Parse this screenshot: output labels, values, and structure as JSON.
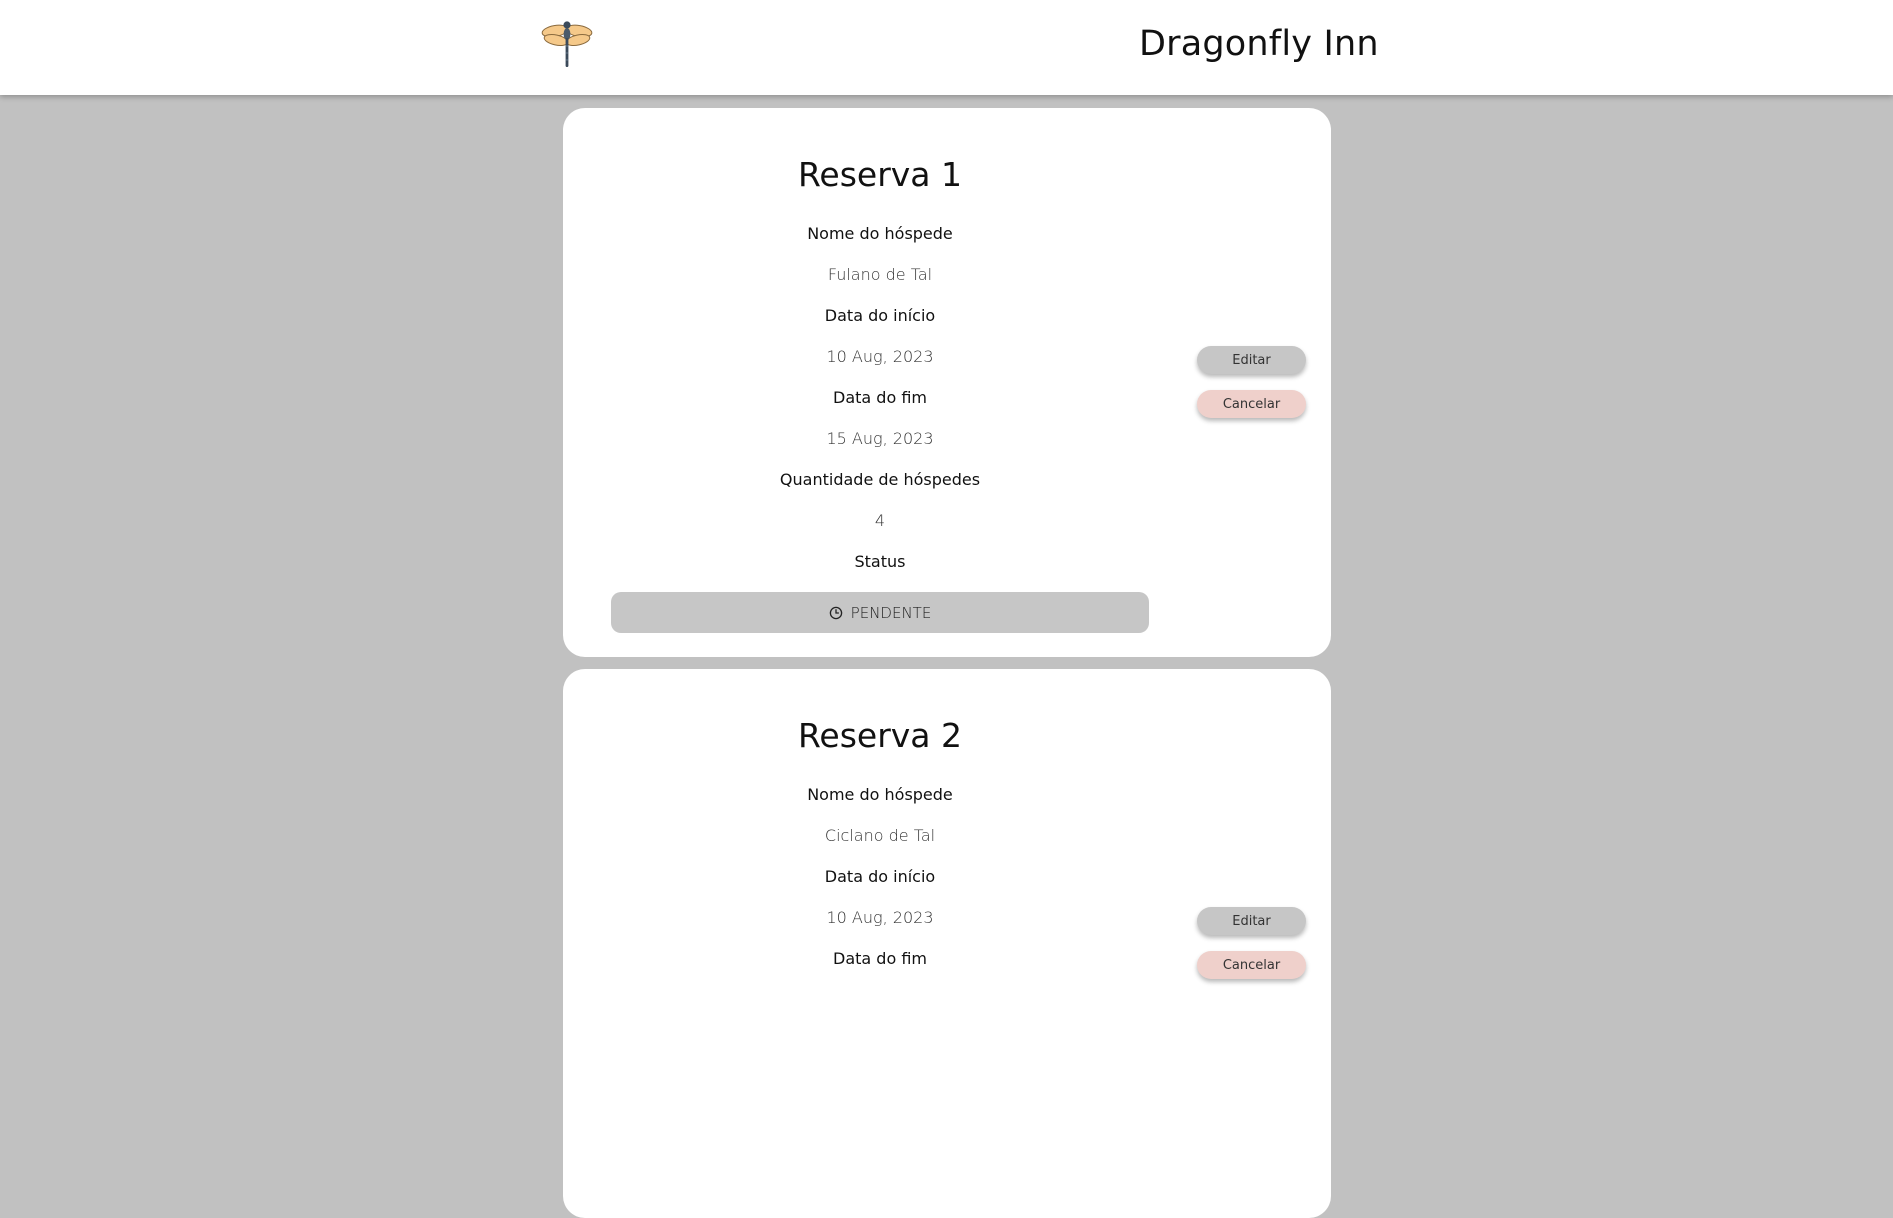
{
  "header": {
    "brand": "Dragonfly Inn",
    "logo_icon": "dragonfly-icon"
  },
  "labels": {
    "guest_name": "Nome do hóspede",
    "start_date": "Data do início",
    "end_date": "Data do fim",
    "guest_count": "Quantidade de hóspedes",
    "status": "Status",
    "edit": "Editar",
    "cancel": "Cancelar"
  },
  "reservations": [
    {
      "title": "Reserva 1",
      "guest_name": "Fulano de Tal",
      "start_date": "10 Aug, 2023",
      "end_date": "15 Aug, 2023",
      "guest_count": "4",
      "status": "PENDENTE",
      "status_icon": "clock-icon"
    },
    {
      "title": "Reserva 2",
      "guest_name": "Ciclano de Tal",
      "start_date": "10 Aug, 2023"
    }
  ],
  "colors": {
    "page_background": "#c1c1c1",
    "card_background": "#ffffff",
    "status_pending": "#c6c6c6",
    "edit_button": "#c6c6c6",
    "cancel_button": "#efd0cb"
  }
}
